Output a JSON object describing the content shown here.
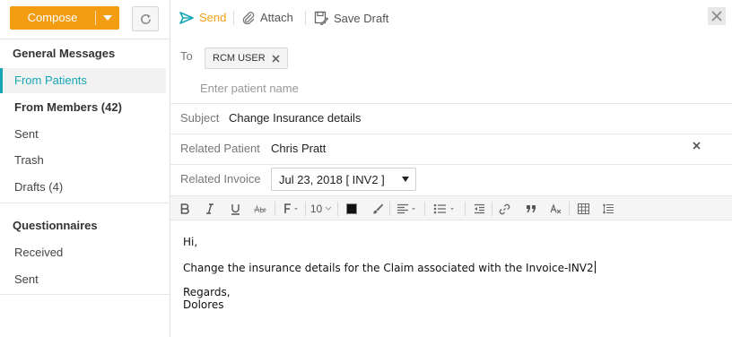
{
  "sidebar": {
    "compose_label": "Compose",
    "general_title": "General Messages",
    "items": [
      {
        "label": "From Patients"
      },
      {
        "label": "From Members (42)"
      },
      {
        "label": "Sent"
      },
      {
        "label": "Trash"
      },
      {
        "label": "Drafts (4)"
      }
    ],
    "questionnaires_title": "Questionnaires",
    "q_items": [
      {
        "label": "Received"
      },
      {
        "label": "Sent"
      }
    ]
  },
  "toolbar": {
    "send_label": "Send",
    "attach_label": "Attach",
    "save_draft_label": "Save Draft"
  },
  "form": {
    "to_label": "To",
    "recipient_chip": "RCM USER",
    "patient_placeholder": "Enter patient name",
    "subject_label": "Subject",
    "subject_value": "Change Insurance details",
    "related_patient_label": "Related Patient",
    "related_patient_value": "Chris Pratt",
    "related_invoice_label": "Related Invoice",
    "related_invoice_value": "Jul 23, 2018 [ INV2 ]"
  },
  "editor_toolbar": {
    "font_size": "10"
  },
  "body": {
    "line1": "Hi,",
    "line2": "Change the insurance details for the Claim associated with the Invoice-INV2",
    "line3": "Regards,",
    "line4": "Dolores"
  },
  "colors": {
    "accent": "#f39c12",
    "active": "#16a6b6"
  }
}
